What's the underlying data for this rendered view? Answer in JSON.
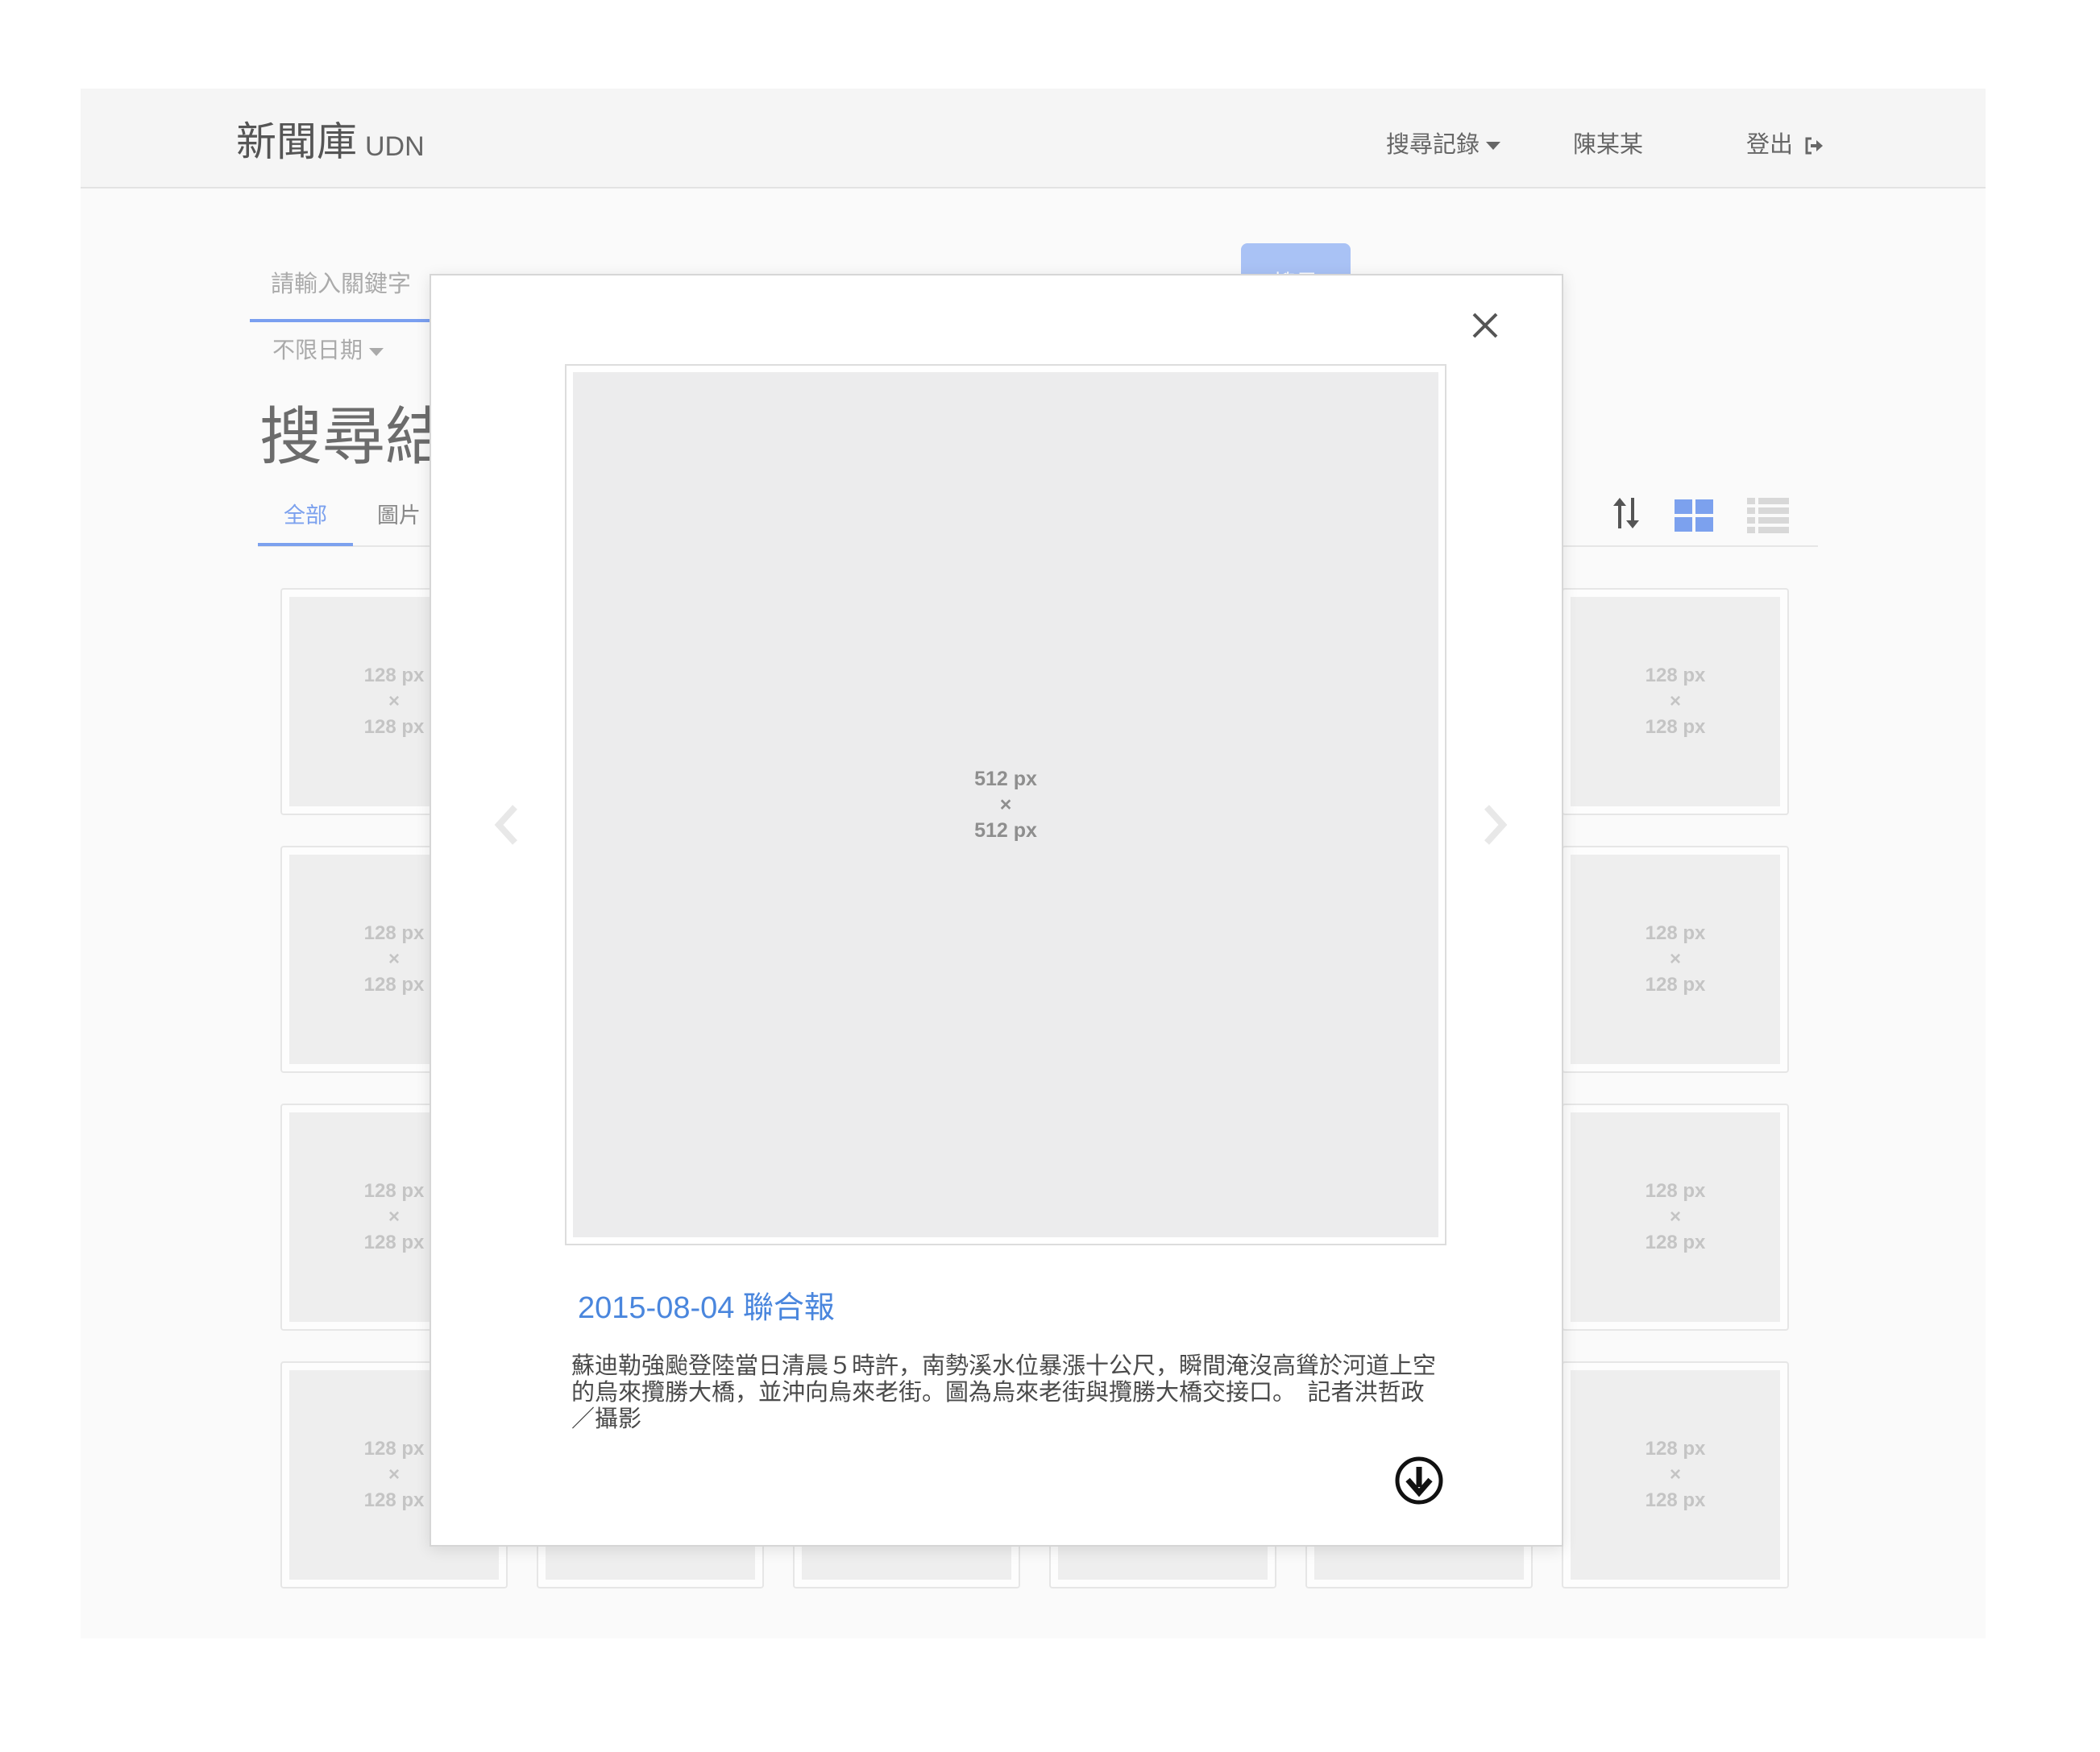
{
  "navbar": {
    "brand": "新聞庫",
    "brand_sub": "UDN",
    "history_label": "搜尋記錄",
    "user_name": "陳某某",
    "logout_label": "登出"
  },
  "search": {
    "placeholder": "請輸入關鍵字",
    "button_label": "搜尋",
    "date_filter": "不限日期"
  },
  "results": {
    "title": "搜尋結果",
    "tabs": [
      {
        "label": "全部",
        "active": true
      },
      {
        "label": "圖片",
        "active": false
      }
    ]
  },
  "placeholder_thumb": {
    "line1": "128 px",
    "line2": "×",
    "line3": "128 px"
  },
  "modal": {
    "image": {
      "line1": "512 px",
      "line2": "×",
      "line3": "512 px"
    },
    "heading": "2015-08-04 聯合報",
    "caption": "蘇迪勒強颱登陸當日清晨５時許，南勢溪水位暴漲十公尺，瞬間淹沒高聳於河道上空的烏來攬勝大橋，並沖向烏來老街。圖為烏來老街與攬勝大橋交接口。　記者洪哲政／攝影"
  },
  "colors": {
    "accent": "#4a86dd",
    "tab_active": "#7ca1ee",
    "button_bg": "#a9c2f5"
  },
  "icons": {
    "close": "close-icon",
    "prev": "chevron-left-icon",
    "next": "chevron-right-icon",
    "download": "download-circle-icon",
    "sort": "sort-icon",
    "grid_view": "grid-view-icon",
    "list_view": "list-view-icon",
    "logout": "logout-icon"
  }
}
